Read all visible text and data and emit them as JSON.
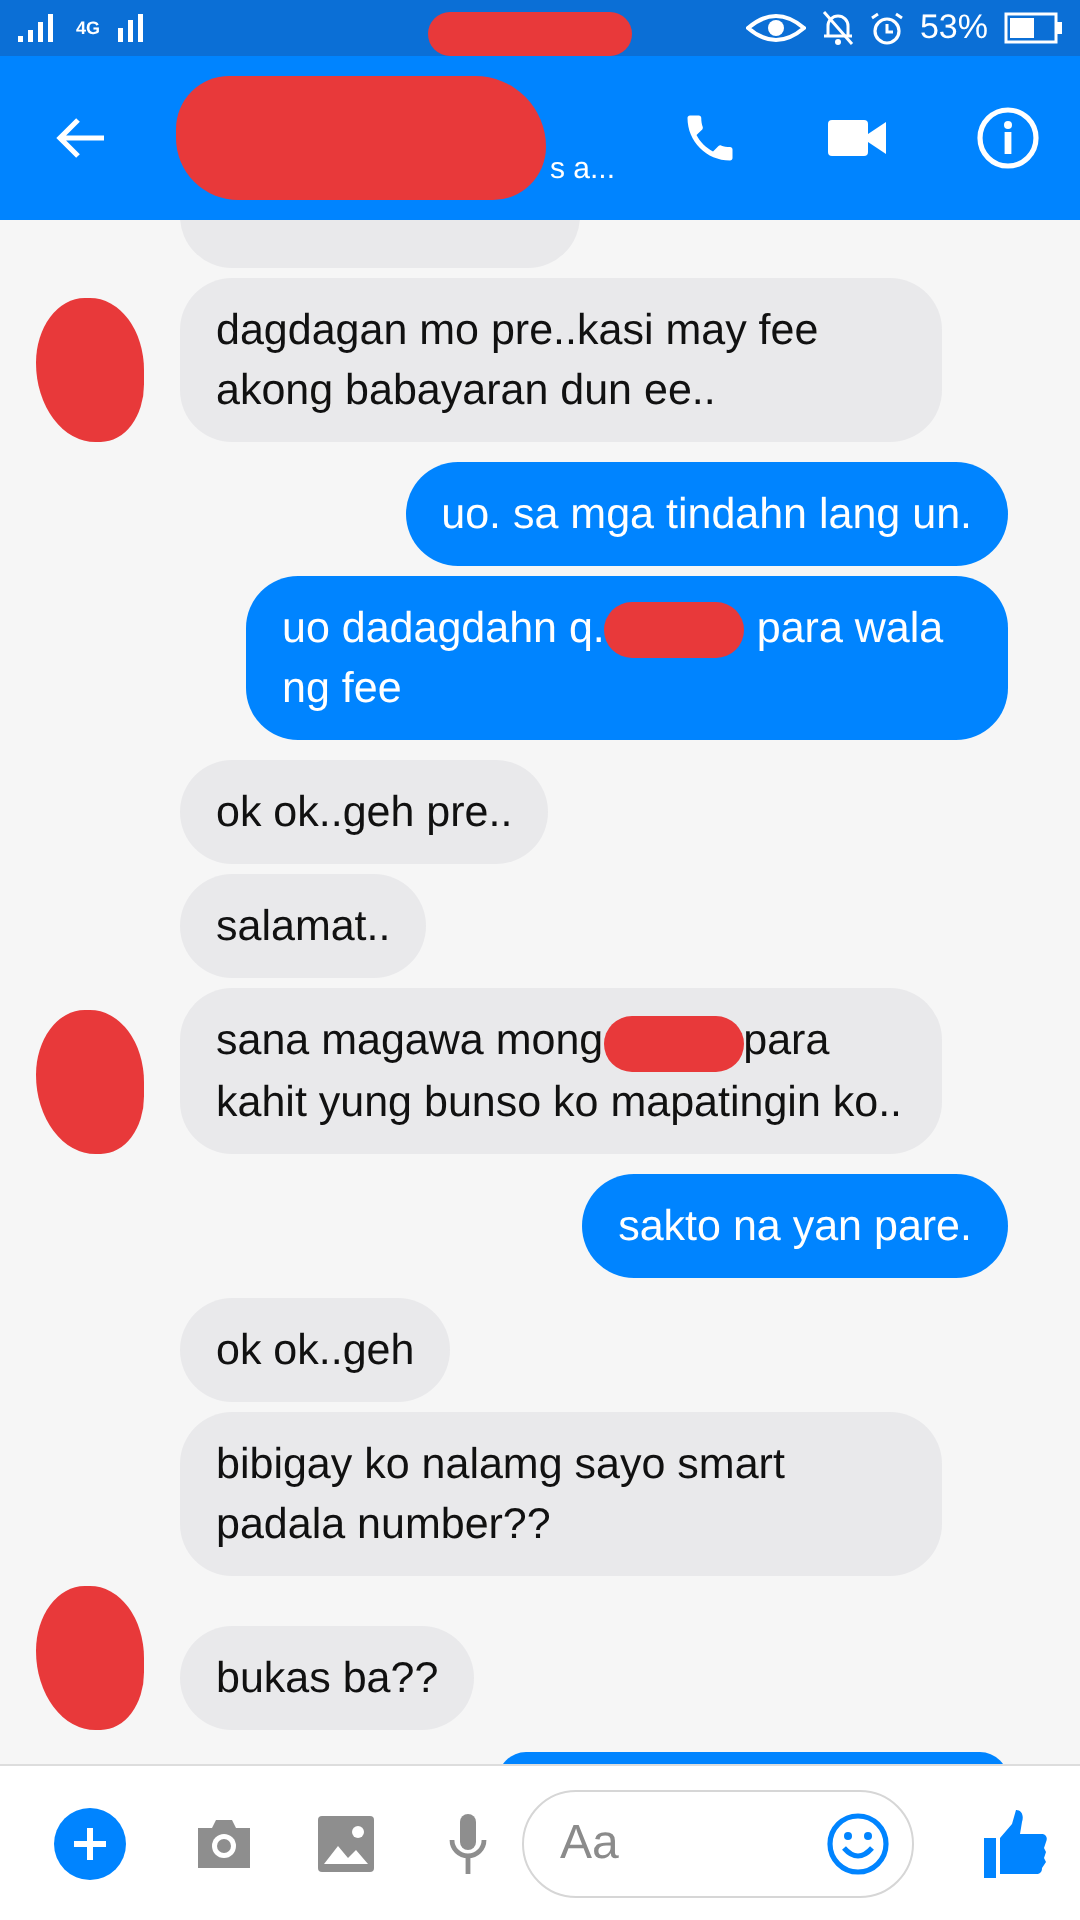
{
  "status_bar": {
    "network": "4G",
    "battery": "53%",
    "time_redacted": true
  },
  "header": {
    "name_redacted": true,
    "subtitle": "s a..."
  },
  "messages": [
    {
      "kind": "partial",
      "outgoing": false
    },
    {
      "kind": "text",
      "outgoing": false,
      "avatar": true,
      "parts": [
        {
          "text": "dagdagan mo pre..kasi may fee akong babayaran dun ee.."
        }
      ]
    },
    {
      "kind": "text",
      "outgoing": true,
      "parts": [
        {
          "text": "uo. sa mga tindahn lang un."
        }
      ]
    },
    {
      "kind": "text",
      "outgoing": true,
      "parts": [
        {
          "text": "uo dadagdahn q."
        },
        {
          "kind": "redaction"
        },
        {
          "text": " para wala ng fee"
        }
      ]
    },
    {
      "kind": "text",
      "outgoing": false,
      "parts": [
        {
          "text": "ok ok..geh pre.."
        }
      ]
    },
    {
      "kind": "text",
      "outgoing": false,
      "parts": [
        {
          "text": "salamat.."
        }
      ]
    },
    {
      "kind": "text",
      "outgoing": false,
      "avatar": true,
      "parts": [
        {
          "text": "sana magawa mong"
        },
        {
          "kind": "redaction"
        },
        {
          "text": "para kahit yung bunso ko mapatingin ko.."
        }
      ]
    },
    {
      "kind": "text",
      "outgoing": true,
      "parts": [
        {
          "text": "sakto na yan pare."
        }
      ]
    },
    {
      "kind": "text",
      "outgoing": false,
      "parts": [
        {
          "text": "ok ok..geh"
        }
      ]
    },
    {
      "kind": "text",
      "outgoing": false,
      "parts": [
        {
          "text": "bibigay ko nalamg sayo smart padala number??"
        }
      ]
    },
    {
      "kind": "text",
      "outgoing": false,
      "avatar": true,
      "parts": [
        {
          "text": "bukas ba??"
        }
      ]
    },
    {
      "kind": "partial",
      "outgoing": true
    }
  ],
  "composer": {
    "placeholder": "Aa"
  }
}
